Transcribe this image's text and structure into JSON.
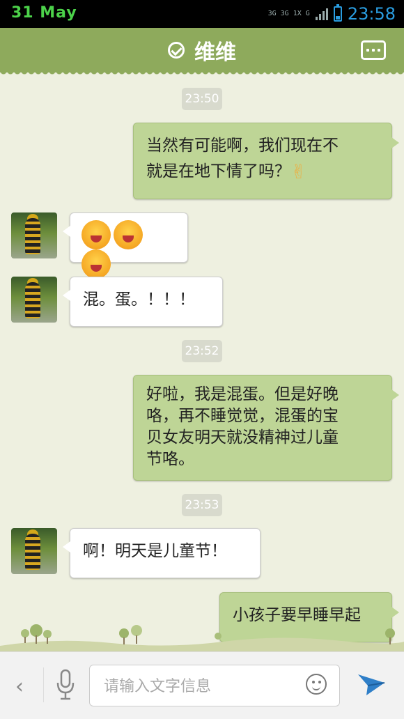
{
  "status_bar": {
    "date": "31 May",
    "network": [
      "3G",
      "3G",
      "1X",
      "G"
    ],
    "battery_level": 0.3,
    "time": "23:58"
  },
  "header": {
    "title": "维维"
  },
  "messages": [
    {
      "type": "timestamp",
      "text": "23:50"
    },
    {
      "type": "outgoing",
      "lines": [
        "当然有可能啊，我们现在不",
        "就是在地下情了吗？"
      ],
      "trailing_emoji": "victory-hand"
    },
    {
      "type": "incoming",
      "emoji": [
        "laughing-face",
        "laughing-face",
        "laughing-face"
      ]
    },
    {
      "type": "incoming",
      "text": "混。蛋。！！！"
    },
    {
      "type": "timestamp",
      "text": "23:52"
    },
    {
      "type": "outgoing",
      "lines": [
        "好啦，我是混蛋。但是好晚",
        "咯，再不睡觉觉，混蛋的宝",
        "贝女友明天就没精神过儿童",
        "节咯。"
      ]
    },
    {
      "type": "timestamp",
      "text": "23:53"
    },
    {
      "type": "incoming",
      "text": "啊！明天是儿童节！"
    },
    {
      "type": "outgoing",
      "lines": [
        "小孩子要早睡早起"
      ]
    }
  ],
  "input_bar": {
    "placeholder": "请输入文字信息"
  },
  "colors": {
    "title_bar": "#8eaa5c",
    "outgoing_bubble": "#bed596",
    "incoming_bubble": "#ffffff",
    "chat_background": "#eef0e0",
    "status_time": "#2a9de0",
    "status_date": "#4cd24a"
  },
  "icons": [
    "check-circle-icon",
    "more-icon",
    "back-arrow-icon",
    "microphone-icon",
    "smiley-icon",
    "send-icon"
  ]
}
